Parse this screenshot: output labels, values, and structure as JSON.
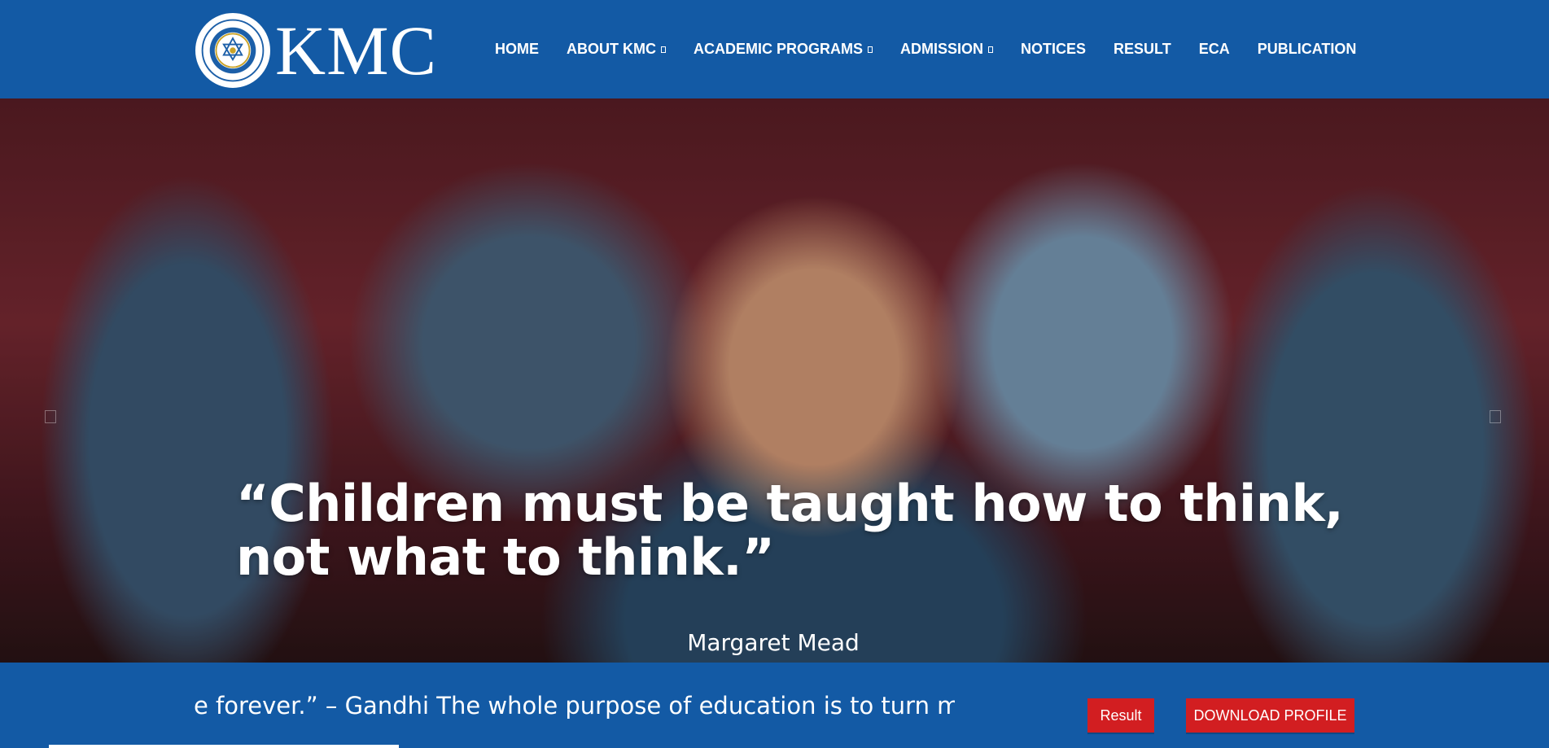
{
  "header": {
    "logo_text": "KMC",
    "seal_text": "KATHMANDU MODEL HIGHER SECONDARY SCHOOL · KATHMANDU"
  },
  "nav": {
    "items": [
      {
        "label": "HOME",
        "dropdown": false
      },
      {
        "label": "ABOUT KMC",
        "dropdown": true
      },
      {
        "label": "ACADEMIC PROGRAMS",
        "dropdown": true
      },
      {
        "label": "ADMISSION",
        "dropdown": true
      },
      {
        "label": "NOTICES",
        "dropdown": false
      },
      {
        "label": "RESULT",
        "dropdown": false
      },
      {
        "label": "ECA",
        "dropdown": false
      },
      {
        "label": "PUBLICATION",
        "dropdown": false
      }
    ]
  },
  "hero": {
    "quote_line1": "“Children must be taught how to think,",
    "quote_line2": "not what to think.”",
    "author": "Margaret Mead"
  },
  "ticker": {
    "text": "e forever.” – Gandhi The whole purpose of education is to turn mirrors into "
  },
  "buttons": {
    "result": "Result",
    "download_profile": "DOWNLOAD PROFILE"
  },
  "colors": {
    "brand_blue": "#135aa5",
    "button_red": "#d21e21"
  }
}
